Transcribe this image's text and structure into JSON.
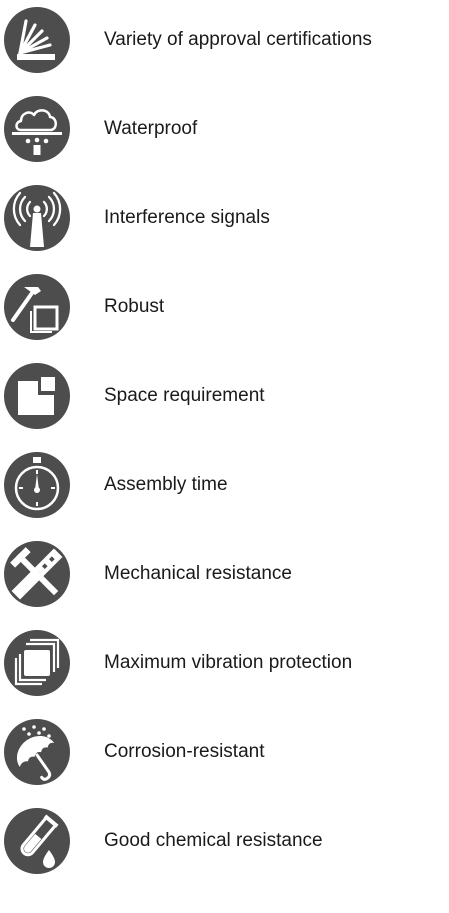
{
  "icon_color": "#4d4d4d",
  "features": [
    {
      "label": "Variety of approval certifications",
      "icon": "certification-bars-icon"
    },
    {
      "label": "Waterproof",
      "icon": "rain-cloud-icon"
    },
    {
      "label": "Interference signals",
      "icon": "antenna-signal-icon"
    },
    {
      "label": "Robust",
      "icon": "hammer-box-icon"
    },
    {
      "label": "Space requirement",
      "icon": "space-corner-icon"
    },
    {
      "label": "Assembly time",
      "icon": "stopwatch-icon"
    },
    {
      "label": "Mechanical resistance",
      "icon": "saw-tools-icon"
    },
    {
      "label": "Maximum vibration protection",
      "icon": "vibration-squares-icon"
    },
    {
      "label": "Corrosion-resistant",
      "icon": "umbrella-icon"
    },
    {
      "label": "Good chemical resistance",
      "icon": "test-tube-icon"
    }
  ]
}
